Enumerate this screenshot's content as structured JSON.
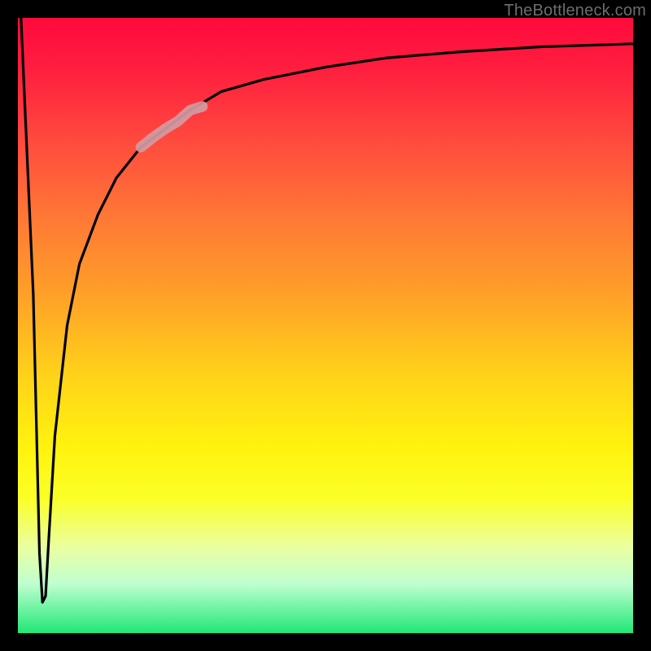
{
  "watermark": {
    "text": "TheBottleneck.com"
  },
  "colors": {
    "frame": "#000000",
    "curve": "#000000",
    "highlight": "#d49aa2",
    "gradient_top": "#ff0a3c",
    "gradient_mid": "#ffd21a",
    "gradient_bottom": "#20e777"
  },
  "chart_data": {
    "type": "line",
    "title": "",
    "xlabel": "",
    "ylabel": "",
    "xlim": [
      0,
      100
    ],
    "ylim": [
      0,
      100
    ],
    "grid": false,
    "legend": false,
    "annotations": [],
    "series": [
      {
        "name": "bottleneck-curve",
        "x": [
          0.5,
          2.5,
          3.5,
          4.0,
          4.5,
          5.0,
          6.0,
          8.0,
          10.0,
          13.0,
          16.0,
          20.0,
          24.0,
          28.0,
          33.0,
          40.0,
          50.0,
          60.0,
          72.0,
          85.0,
          100.0
        ],
        "y": [
          100,
          55,
          13,
          5,
          6,
          15,
          32,
          50,
          60,
          68,
          74,
          79,
          82,
          85,
          88,
          90,
          92,
          93.5,
          94.5,
          95.3,
          95.8
        ]
      },
      {
        "name": "highlight-segment",
        "x": [
          20.0,
          22.0,
          24.0,
          26.0,
          28.0,
          30.0
        ],
        "y": [
          79.0,
          80.6,
          82.0,
          83.2,
          85.0,
          85.6
        ]
      }
    ]
  }
}
